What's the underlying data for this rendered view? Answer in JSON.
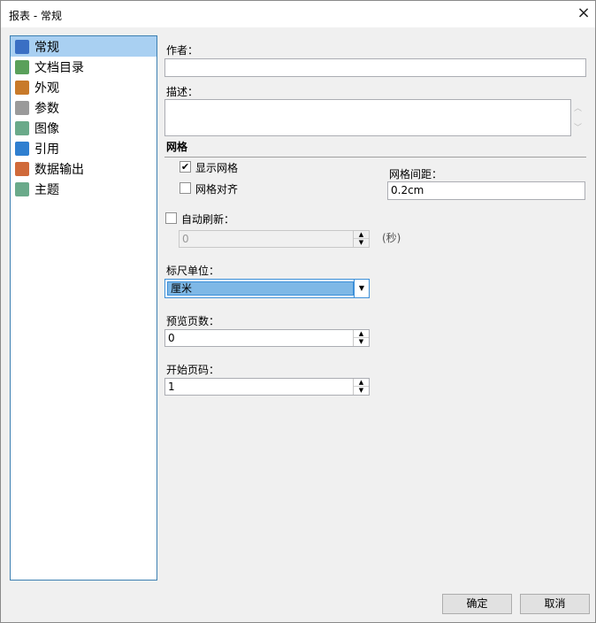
{
  "window": {
    "title": "报表 - 常规",
    "close_icon": "×"
  },
  "sidebar": {
    "items": [
      {
        "label": "常规",
        "icon": "report-icon",
        "color": "#3a6fc4",
        "selected": true
      },
      {
        "label": "文档目录",
        "icon": "picture-icon",
        "color": "#5aa05a"
      },
      {
        "label": "外观",
        "icon": "palette-icon",
        "color": "#c87a2a"
      },
      {
        "label": "参数",
        "icon": "parameter-icon",
        "color": "#9a9a9a"
      },
      {
        "label": "图像",
        "icon": "image-icon",
        "color": "#6aaa8a"
      },
      {
        "label": "引用",
        "icon": "reference-icon",
        "color": "#2f7fd0"
      },
      {
        "label": "数据输出",
        "icon": "data-export-icon",
        "color": "#d06a3a"
      },
      {
        "label": "主题",
        "icon": "theme-icon",
        "color": "#6aaa8a"
      }
    ]
  },
  "form": {
    "author_label": "作者：",
    "author_value": "",
    "description_label": "描述：",
    "description_value": "",
    "grid_section": "网格",
    "show_grid_label": "显示网格",
    "show_grid_checked": "✔",
    "snap_grid_label": "网格对齐",
    "grid_spacing_label": "网格间距：",
    "grid_spacing_value": "0.2cm",
    "auto_refresh_label": "自动刷新：",
    "auto_refresh_value": "0",
    "seconds_label": "(秒)",
    "ruler_unit_label": "标尺单位：",
    "ruler_unit_value": "厘米",
    "preview_pages_label": "预览页数：",
    "preview_pages_value": "0",
    "start_page_label": "开始页码：",
    "start_page_value": "1"
  },
  "buttons": {
    "ok": "确定",
    "cancel": "取消"
  }
}
